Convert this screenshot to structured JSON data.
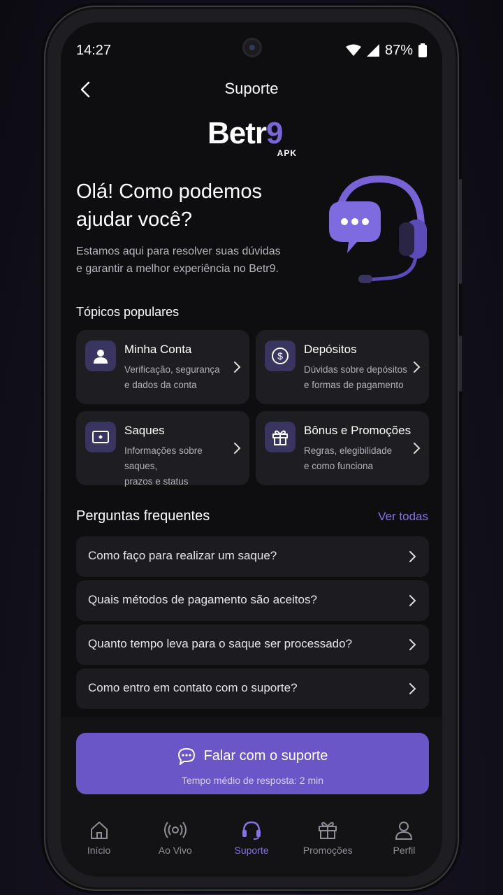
{
  "status": {
    "time": "14:27",
    "battery": "87%"
  },
  "header": {
    "title": "Suporte"
  },
  "logo": {
    "word": "Betr",
    "nine": "9",
    "apk": "APK"
  },
  "hero": {
    "title_line1": "Olá! Como podemos",
    "title_line2": "ajudar você?",
    "subtitle_line1": "Estamos aqui para resolver suas dúvidas",
    "subtitle_line2": "e garantir a melhor experiência no Betr9."
  },
  "topics": {
    "title": "Tópicos populares",
    "items": [
      {
        "title": "Minha Conta",
        "desc1": "Verificação, segurança",
        "desc2": "e dados da conta",
        "icon": "user-icon"
      },
      {
        "title": "Depósitos",
        "desc1": "Dúvidas sobre depósitos",
        "desc2": "e formas de pagamento",
        "icon": "dollar-icon"
      },
      {
        "title": "Saques",
        "desc1": "Informações sobre saques,",
        "desc2": "prazos e status",
        "icon": "cash-icon"
      },
      {
        "title": "Bônus e Promoções",
        "desc1": "Regras, elegibilidade",
        "desc2": "e como funciona",
        "icon": "gift-icon"
      }
    ]
  },
  "faq": {
    "title": "Perguntas frequentes",
    "see_all": "Ver todas",
    "items": [
      "Como faço para realizar um saque?",
      "Quais métodos de pagamento são aceitos?",
      "Quanto tempo leva para o saque ser processado?",
      "Como entro em contato com o suporte?"
    ]
  },
  "cta": {
    "label": "Falar com o suporte",
    "sub": "Tempo médio de resposta: 2 min"
  },
  "nav": {
    "items": [
      {
        "label": "Início",
        "icon": "home-icon"
      },
      {
        "label": "Ao Vivo",
        "icon": "broadcast-icon"
      },
      {
        "label": "Suporte",
        "icon": "headset-icon"
      },
      {
        "label": "Promoções",
        "icon": "gift-icon"
      },
      {
        "label": "Perfil",
        "icon": "person-icon"
      }
    ],
    "active": "Suporte"
  },
  "colors": {
    "accent": "#6a56c6",
    "accent_light": "#8572e6",
    "background": "#0e0e11",
    "card": "#1d1d22"
  }
}
